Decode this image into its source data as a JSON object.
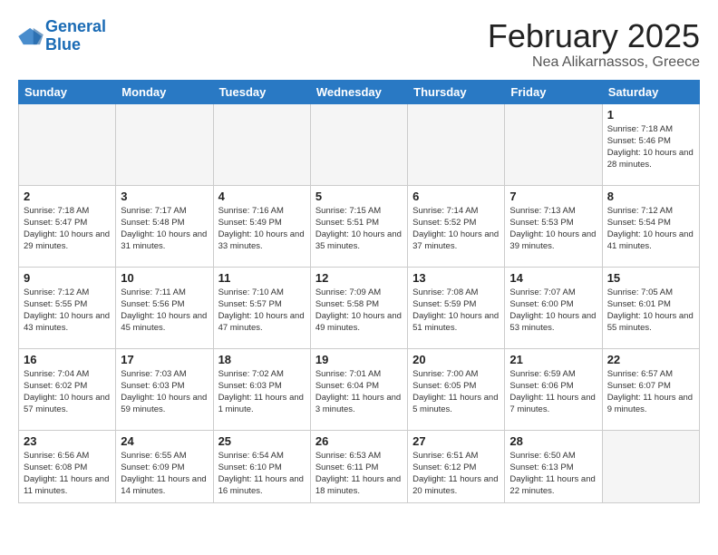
{
  "header": {
    "logo_line1": "General",
    "logo_line2": "Blue",
    "title": "February 2025",
    "subtitle": "Nea Alikarnassos, Greece"
  },
  "weekdays": [
    "Sunday",
    "Monday",
    "Tuesday",
    "Wednesday",
    "Thursday",
    "Friday",
    "Saturday"
  ],
  "weeks": [
    [
      {
        "day": "",
        "info": ""
      },
      {
        "day": "",
        "info": ""
      },
      {
        "day": "",
        "info": ""
      },
      {
        "day": "",
        "info": ""
      },
      {
        "day": "",
        "info": ""
      },
      {
        "day": "",
        "info": ""
      },
      {
        "day": "1",
        "info": "Sunrise: 7:18 AM\nSunset: 5:46 PM\nDaylight: 10 hours and 28 minutes."
      }
    ],
    [
      {
        "day": "2",
        "info": "Sunrise: 7:18 AM\nSunset: 5:47 PM\nDaylight: 10 hours and 29 minutes."
      },
      {
        "day": "3",
        "info": "Sunrise: 7:17 AM\nSunset: 5:48 PM\nDaylight: 10 hours and 31 minutes."
      },
      {
        "day": "4",
        "info": "Sunrise: 7:16 AM\nSunset: 5:49 PM\nDaylight: 10 hours and 33 minutes."
      },
      {
        "day": "5",
        "info": "Sunrise: 7:15 AM\nSunset: 5:51 PM\nDaylight: 10 hours and 35 minutes."
      },
      {
        "day": "6",
        "info": "Sunrise: 7:14 AM\nSunset: 5:52 PM\nDaylight: 10 hours and 37 minutes."
      },
      {
        "day": "7",
        "info": "Sunrise: 7:13 AM\nSunset: 5:53 PM\nDaylight: 10 hours and 39 minutes."
      },
      {
        "day": "8",
        "info": "Sunrise: 7:12 AM\nSunset: 5:54 PM\nDaylight: 10 hours and 41 minutes."
      }
    ],
    [
      {
        "day": "9",
        "info": "Sunrise: 7:12 AM\nSunset: 5:55 PM\nDaylight: 10 hours and 43 minutes."
      },
      {
        "day": "10",
        "info": "Sunrise: 7:11 AM\nSunset: 5:56 PM\nDaylight: 10 hours and 45 minutes."
      },
      {
        "day": "11",
        "info": "Sunrise: 7:10 AM\nSunset: 5:57 PM\nDaylight: 10 hours and 47 minutes."
      },
      {
        "day": "12",
        "info": "Sunrise: 7:09 AM\nSunset: 5:58 PM\nDaylight: 10 hours and 49 minutes."
      },
      {
        "day": "13",
        "info": "Sunrise: 7:08 AM\nSunset: 5:59 PM\nDaylight: 10 hours and 51 minutes."
      },
      {
        "day": "14",
        "info": "Sunrise: 7:07 AM\nSunset: 6:00 PM\nDaylight: 10 hours and 53 minutes."
      },
      {
        "day": "15",
        "info": "Sunrise: 7:05 AM\nSunset: 6:01 PM\nDaylight: 10 hours and 55 minutes."
      }
    ],
    [
      {
        "day": "16",
        "info": "Sunrise: 7:04 AM\nSunset: 6:02 PM\nDaylight: 10 hours and 57 minutes."
      },
      {
        "day": "17",
        "info": "Sunrise: 7:03 AM\nSunset: 6:03 PM\nDaylight: 10 hours and 59 minutes."
      },
      {
        "day": "18",
        "info": "Sunrise: 7:02 AM\nSunset: 6:03 PM\nDaylight: 11 hours and 1 minute."
      },
      {
        "day": "19",
        "info": "Sunrise: 7:01 AM\nSunset: 6:04 PM\nDaylight: 11 hours and 3 minutes."
      },
      {
        "day": "20",
        "info": "Sunrise: 7:00 AM\nSunset: 6:05 PM\nDaylight: 11 hours and 5 minutes."
      },
      {
        "day": "21",
        "info": "Sunrise: 6:59 AM\nSunset: 6:06 PM\nDaylight: 11 hours and 7 minutes."
      },
      {
        "day": "22",
        "info": "Sunrise: 6:57 AM\nSunset: 6:07 PM\nDaylight: 11 hours and 9 minutes."
      }
    ],
    [
      {
        "day": "23",
        "info": "Sunrise: 6:56 AM\nSunset: 6:08 PM\nDaylight: 11 hours and 11 minutes."
      },
      {
        "day": "24",
        "info": "Sunrise: 6:55 AM\nSunset: 6:09 PM\nDaylight: 11 hours and 14 minutes."
      },
      {
        "day": "25",
        "info": "Sunrise: 6:54 AM\nSunset: 6:10 PM\nDaylight: 11 hours and 16 minutes."
      },
      {
        "day": "26",
        "info": "Sunrise: 6:53 AM\nSunset: 6:11 PM\nDaylight: 11 hours and 18 minutes."
      },
      {
        "day": "27",
        "info": "Sunrise: 6:51 AM\nSunset: 6:12 PM\nDaylight: 11 hours and 20 minutes."
      },
      {
        "day": "28",
        "info": "Sunrise: 6:50 AM\nSunset: 6:13 PM\nDaylight: 11 hours and 22 minutes."
      },
      {
        "day": "",
        "info": ""
      }
    ]
  ]
}
